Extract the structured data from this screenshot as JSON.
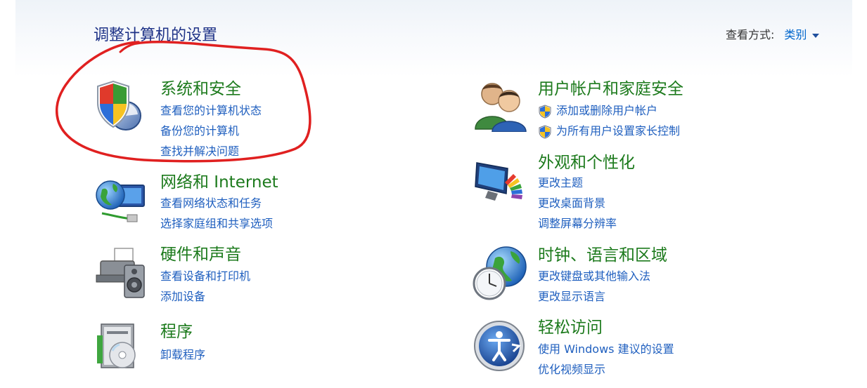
{
  "header": {
    "title": "调整计算机的设置",
    "view_by_label": "查看方式:",
    "view_by_value": "类别"
  },
  "left_categories": [
    {
      "title": "系统和安全",
      "icon": "shield-icon",
      "links": [
        "查看您的计算机状态",
        "备份您的计算机",
        "查找并解决问题"
      ]
    },
    {
      "title": "网络和 Internet",
      "icon": "network-globe-icon",
      "links": [
        "查看网络状态和任务",
        "选择家庭组和共享选项"
      ]
    },
    {
      "title": "硬件和声音",
      "icon": "printer-speaker-icon",
      "links": [
        "查看设备和打印机",
        "添加设备"
      ]
    },
    {
      "title": "程序",
      "icon": "programs-disc-icon",
      "links": [
        "卸载程序"
      ]
    }
  ],
  "right_categories": [
    {
      "title": "用户帐户和家庭安全",
      "icon": "users-icon",
      "links": [
        "添加或删除用户帐户",
        "为所有用户设置家长控制"
      ],
      "link_icons": [
        "uac-shield-icon",
        "uac-shield-icon"
      ]
    },
    {
      "title": "外观和个性化",
      "icon": "monitor-palette-icon",
      "links": [
        "更改主题",
        "更改桌面背景",
        "调整屏幕分辨率"
      ]
    },
    {
      "title": "时钟、语言和区域",
      "icon": "clock-globe-icon",
      "links": [
        "更改键盘或其他输入法",
        "更改显示语言"
      ]
    },
    {
      "title": "轻松访问",
      "icon": "accessibility-icon",
      "links": [
        "使用 Windows 建议的设置",
        "优化视频显示"
      ]
    }
  ],
  "colors": {
    "title_blue": "#1e3287",
    "category_green": "#1c7a1c",
    "link_blue": "#1f5fbf",
    "annotation_red": "#e02020"
  }
}
